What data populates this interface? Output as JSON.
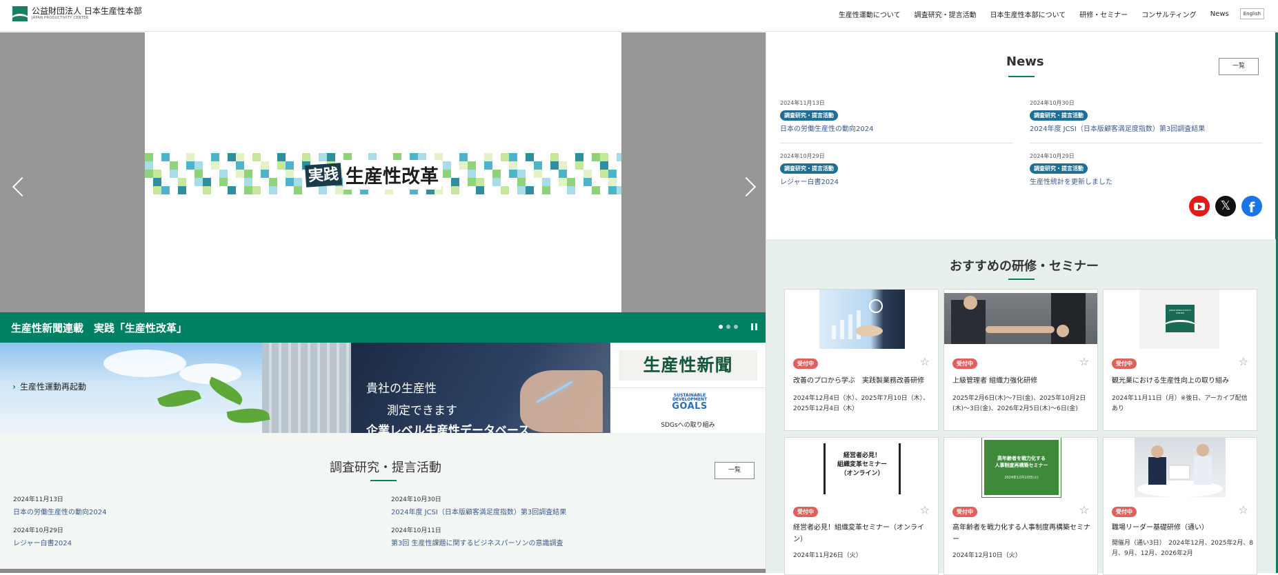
{
  "header": {
    "logo_main": "公益財団法人 日本生産性本部",
    "logo_sub": "JAPAN PRODUCTIVITY CENTER",
    "nav": [
      "生産性運動について",
      "調査研究・提言活動",
      "日本生産性本部について",
      "研修・セミナー",
      "コンサルティング",
      "News"
    ],
    "lang": "English"
  },
  "hero": {
    "badge": "実践",
    "title": "生産性改革",
    "caption": "生産性新聞連載　実践「生産性改革」",
    "slide_count": 3,
    "active_slide": 1
  },
  "banners": {
    "restart": "生産性運動再起動",
    "measure_line1": "貴社の生産性",
    "measure_line2": "測定できます",
    "measure_line3": "企業レベル生産性データベース",
    "newspaper": "生産性新聞",
    "sdg_top": "SUSTAINABLE DEVELOPMENT",
    "sdg_goals": "GOALS",
    "sdg_label": "SDGsへの取り組み"
  },
  "research": {
    "title": "調査研究・提言活動",
    "more": "一覧",
    "items": [
      {
        "date": "2024年11月13日",
        "title": "日本の労働生産性の動向2024"
      },
      {
        "date": "2024年10月30日",
        "title": "2024年度 JCSI（日本版顧客満足度指数）第3回調査結果"
      },
      {
        "date": "2024年10月29日",
        "title": "レジャー白書2024"
      },
      {
        "date": "2024年10月11日",
        "title": "第3回 生産性課題に関するビジネスパーソンの意識調査"
      }
    ]
  },
  "news": {
    "title": "News",
    "more": "一覧",
    "items": [
      {
        "date": "2024年11月13日",
        "tag": "調査研究・提言活動",
        "title": "日本の労働生産性の動向2024"
      },
      {
        "date": "2024年10月30日",
        "tag": "調査研究・提言活動",
        "title": "2024年度 JCSI（日本版顧客満足度指数）第3回調査結果"
      },
      {
        "date": "2024年10月29日",
        "tag": "調査研究・提言活動",
        "title": "レジャー白書2024"
      },
      {
        "date": "2024年10月29日",
        "tag": "調査研究・提言活動",
        "title": "生産性統計を更新しました"
      }
    ],
    "x_glyph": "𝕏",
    "fb_glyph": "f"
  },
  "seminar": {
    "title": "おすすめの研修・セミナー",
    "cards": [
      {
        "status": "受付中",
        "title": "改善のプロから学ぶ　実践製業務改善研修",
        "date": "2024年12月4日（水）、2025年7月10日（木）、2025年12月4日（木）"
      },
      {
        "status": "受付中",
        "title": "上級管理者 組織力強化研修",
        "date": "2025年2月6日(木)～7日(金)、2025年10月2日(木)～3日(金)、2026年2月5日(木)～6日(金)"
      },
      {
        "status": "受付中",
        "title": "観光業における生産性向上の取り組み",
        "date": "2024年11月11日（月）※後日、アーカイブ配信あり"
      },
      {
        "status": "受付中",
        "title": "経営者必見！組織変革セミナー（オンライン）",
        "date": "2024年11月26日（火）"
      },
      {
        "status": "受付中",
        "title": "高年齢者を戦力化する人事制度再構築セミナー",
        "date": "2024年12月10日（火）"
      },
      {
        "status": "受付中",
        "title": "職場リーダー基礎研修（通い）",
        "date": "開催月（通い3日）　2024年12月、2025年2月、8月、9月、12月、2026年2月"
      }
    ],
    "card4_img_l1": "経営者必見！",
    "card4_img_l2": "組織変革セミナー",
    "card4_img_l3": "（オンライン）",
    "card5_img_l1": "高年齢者を戦力化する",
    "card5_img_l2": "人事制度再構築セミナー",
    "card5_img_date": "2024年12月10日(火)",
    "card3_img_text": "JAPAN PRODUCTIVITY CENTER"
  },
  "colors": {
    "brand": "#008062",
    "tag": "#1f6f95",
    "badge": "#e0605b",
    "link": "#3d5a8a"
  }
}
